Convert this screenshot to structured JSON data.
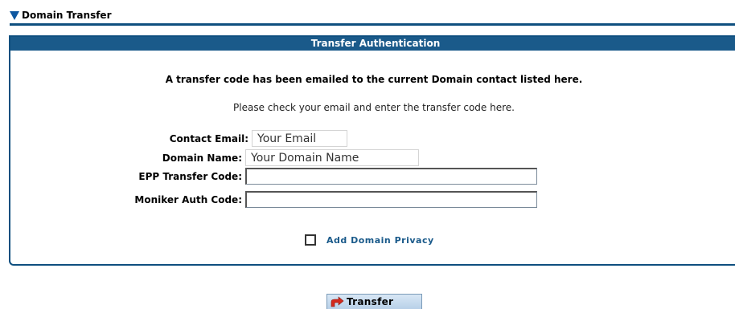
{
  "section": {
    "title": "Domain Transfer",
    "icon": "triangle-down-icon"
  },
  "panel": {
    "title": "Transfer Authentication",
    "notice": "A transfer code has been emailed to the current Domain contact listed here.",
    "instruction": "Please check your email and enter the transfer code here."
  },
  "form": {
    "contact_email_label": "Contact Email:",
    "contact_email_value": "Your Email",
    "domain_name_label": "Domain Name:",
    "domain_name_value": "Your Domain Name",
    "epp_label": "EPP Transfer Code:",
    "epp_value": "",
    "moniker_label": "Moniker Auth Code:",
    "moniker_value": ""
  },
  "privacy": {
    "label": "Add Domain Privacy",
    "checked": false
  },
  "button": {
    "label": "Transfer",
    "icon": "redirect-arrow-icon"
  },
  "colors": {
    "accent": "#1a5a8a",
    "border": "#0e4f7f",
    "arrow": "#d42a1e"
  }
}
